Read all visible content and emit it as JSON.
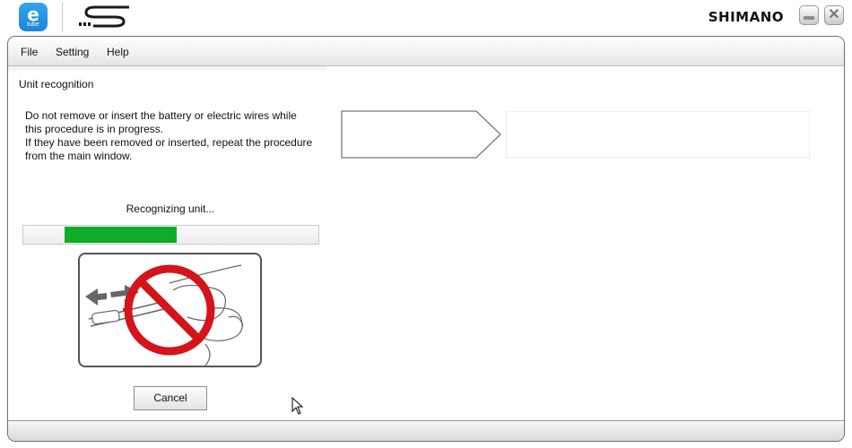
{
  "header": {
    "app_logo_letter": "e",
    "app_logo_sub": "tube",
    "brand": "SHIMANO"
  },
  "menu": {
    "items": [
      {
        "label": "File"
      },
      {
        "label": "Setting"
      },
      {
        "label": "Help"
      }
    ]
  },
  "panel": {
    "title": "Unit recognition",
    "warning_lines": [
      "Do not remove or insert the battery or electric wires while",
      "this procedure is in progress.",
      "If they have been removed or inserted, repeat the procedure",
      "from the main window."
    ],
    "status": "Recognizing unit...",
    "progress": 0.38,
    "cancel_label": "Cancel"
  },
  "colors": {
    "accent_blue": "#1b86d6",
    "progress_green": "#0dad2a",
    "prohibition_red": "#d4141b"
  },
  "icons": {
    "app": "etube-logo",
    "secondary": "s-series-logo",
    "minimize": "minimize-icon",
    "close": "close-icon",
    "cursor": "mouse-pointer-icon"
  }
}
